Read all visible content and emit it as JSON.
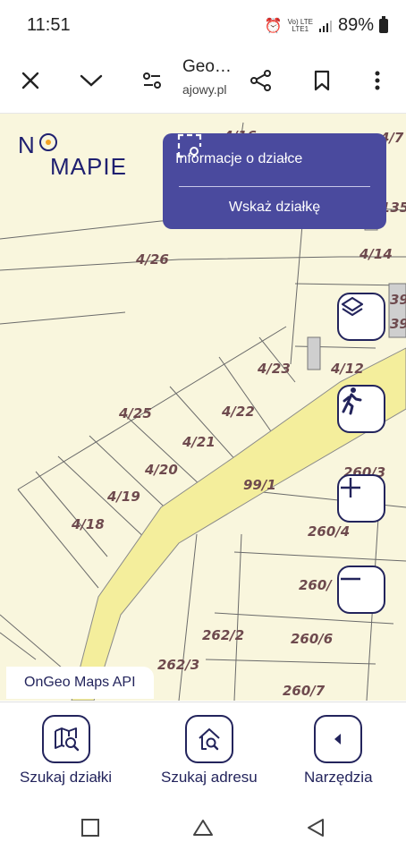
{
  "status_bar": {
    "time": "11:51",
    "network_top": "Vo) LTE",
    "network_bottom": "LTE1",
    "battery": "89%"
  },
  "browser": {
    "title": "Geo…",
    "domain": "ajowy.pl",
    "icons": [
      "close-icon",
      "chevron-down-icon",
      "page-settings-icon",
      "share-icon",
      "bookmark-icon",
      "more-vert-icon"
    ]
  },
  "map": {
    "logo_top": "NO",
    "logo_bottom": "MAPIE",
    "info_panel": {
      "title": "Informacje o działce",
      "action": "Wskaż działkę"
    },
    "plot_labels": [
      "4/16",
      "4/7",
      "4/135",
      "4/14",
      "4/26",
      "39",
      "39",
      "4/23",
      "4/12",
      "4/25",
      "4/22",
      "4/21",
      "4/20",
      "260/3",
      "99/1",
      "4/19",
      "4/18",
      "260/4",
      "260/",
      "262/2",
      "260/6",
      "262/3",
      "260/7"
    ],
    "api_label": "OnGeo Maps API",
    "controls": [
      "layers-icon",
      "walk-icon",
      "zoom-in-icon",
      "zoom-out-icon"
    ]
  },
  "bottom_nav": [
    {
      "label": "Szukaj działki",
      "icon": "map-search-icon"
    },
    {
      "label": "Szukaj adresu",
      "icon": "home-search-icon"
    },
    {
      "label": "Narzędzia",
      "icon": "tools-arrow-icon"
    }
  ],
  "colors": {
    "brand": "#23245c",
    "panel": "#4a4a9e",
    "map_bg": "#f9f6dd",
    "road": "#f4ee9c",
    "label": "#6e4a4e",
    "logo_dot": "#f4a324"
  }
}
